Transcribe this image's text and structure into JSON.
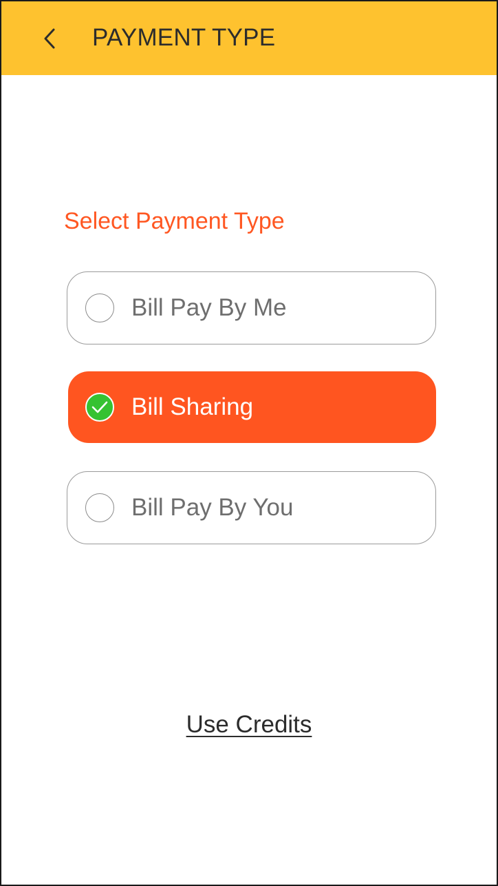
{
  "header": {
    "title": "PAYMENT TYPE",
    "back_icon": "chevron-left-icon"
  },
  "main": {
    "heading": "Select Payment Type",
    "options": [
      {
        "label": "Bill Pay By Me",
        "selected": false
      },
      {
        "label": "Bill Sharing",
        "selected": true
      },
      {
        "label": "Bill Pay By You",
        "selected": false
      }
    ],
    "credits_link": "Use Credits"
  },
  "colors": {
    "header_bg": "#fec22f",
    "accent": "#ff5520",
    "heading_text": "#ff5722",
    "check_green": "#35c232",
    "unselected_text": "#6e6e6e",
    "dark_text": "#2c2c2c"
  }
}
